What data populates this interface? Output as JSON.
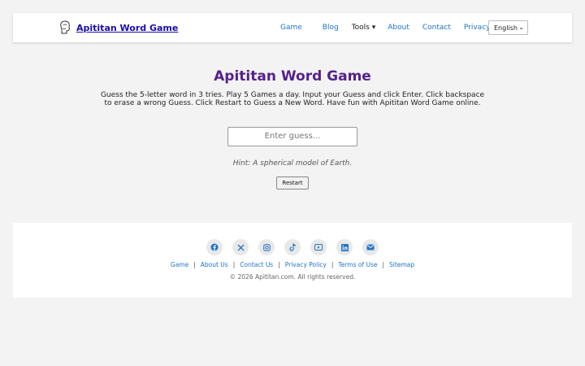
{
  "header": {
    "brand": "Apititan Word Game",
    "nav": [
      "Game",
      "Blog",
      "Tools ▾",
      "About",
      "Contact",
      "Privacy"
    ],
    "language": "English"
  },
  "main": {
    "title": "Apititan Word Game",
    "description": "Guess the 5-letter word in 3 tries. Play 5 Games a day. Input your Guess and click Enter. Click backspace to erase a wrong Guess. Click Restart to Guess a New Word. Have fun with Apititan Word Game online.",
    "guess_placeholder": "Enter guess...",
    "hint": "Hint: A spherical model of Earth.",
    "restart_label": "Restart"
  },
  "footer": {
    "social_icons": [
      "facebook-icon",
      "x-icon",
      "instagram-icon",
      "tiktok-icon",
      "youtube-icon",
      "linkedin-icon",
      "email-icon"
    ],
    "links": [
      "Game",
      "About Us",
      "Contact Us",
      "Privacy Policy",
      "Terms of Use",
      "Sitemap"
    ],
    "copyright": "© 2026 Apititan.com. All rights reserved."
  },
  "colors": {
    "title": "#55218c",
    "link": "#1f74c4",
    "brand": "#1a0dab"
  }
}
